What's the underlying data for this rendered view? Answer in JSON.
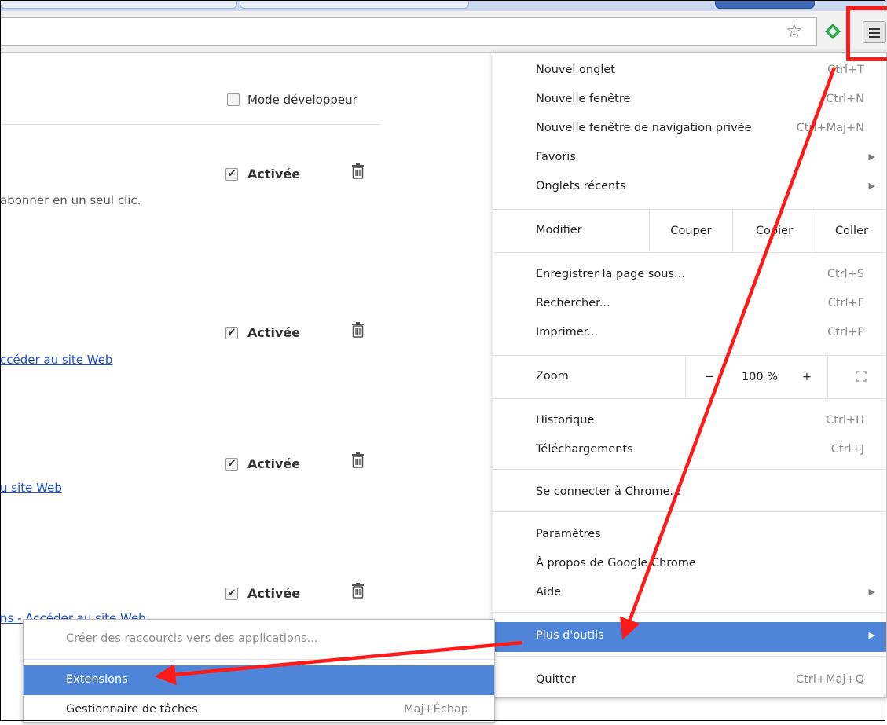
{
  "page": {
    "developer_mode_label": "Mode développeur",
    "extensions": [
      {
        "status": "Activée",
        "text": "abonner en un seul clic.",
        "text_kind": "desc"
      },
      {
        "status": "Activée",
        "text": "ccéder au site Web",
        "text_kind": "link"
      },
      {
        "status": "Activée",
        "text": "u site Web",
        "text_kind": "link"
      },
      {
        "status": "Activée",
        "text": "ns - Accéder au site Web",
        "text_kind": "link"
      }
    ]
  },
  "menu": {
    "new_tab": {
      "label": "Nouvel onglet",
      "shortcut": "Ctrl+T"
    },
    "new_window": {
      "label": "Nouvelle fenêtre",
      "shortcut": "Ctrl+N"
    },
    "new_incognito": {
      "label": "Nouvelle fenêtre de navigation privée",
      "shortcut": "Ctrl+Maj+N"
    },
    "bookmarks": {
      "label": "Favoris"
    },
    "recent_tabs": {
      "label": "Onglets récents"
    },
    "edit": {
      "label": "Modifier",
      "cut": "Couper",
      "copy": "Copier",
      "paste": "Coller"
    },
    "save_page": {
      "label": "Enregistrer la page sous...",
      "shortcut": "Ctrl+S"
    },
    "find": {
      "label": "Rechercher...",
      "shortcut": "Ctrl+F"
    },
    "print": {
      "label": "Imprimer...",
      "shortcut": "Ctrl+P"
    },
    "zoom": {
      "label": "Zoom",
      "minus": "−",
      "value": "100 %",
      "plus": "+"
    },
    "history": {
      "label": "Historique",
      "shortcut": "Ctrl+H"
    },
    "downloads": {
      "label": "Téléchargements",
      "shortcut": "Ctrl+J"
    },
    "sign_in": {
      "label": "Se connecter à Chrome..."
    },
    "settings": {
      "label": "Paramètres"
    },
    "about": {
      "label": "À propos de Google Chrome"
    },
    "help": {
      "label": "Aide"
    },
    "more_tools": {
      "label": "Plus d'outils"
    },
    "quit": {
      "label": "Quitter",
      "shortcut": "Ctrl+Maj+Q"
    }
  },
  "submenu": {
    "create_shortcuts": {
      "label": "Créer des raccourcis vers des applications..."
    },
    "extensions": {
      "label": "Extensions"
    },
    "task_manager": {
      "label": "Gestionnaire de tâches",
      "shortcut": "Maj+Échap"
    }
  },
  "colors": {
    "selected_bg": "#4f85d8",
    "annotation_red": "#ff1a1a",
    "link": "#1a4fd0"
  },
  "icons": [
    "star-icon",
    "extension-icon",
    "menu-icon",
    "checkbox-icon",
    "trash-icon",
    "chevron-right-icon",
    "fullscreen-icon"
  ]
}
